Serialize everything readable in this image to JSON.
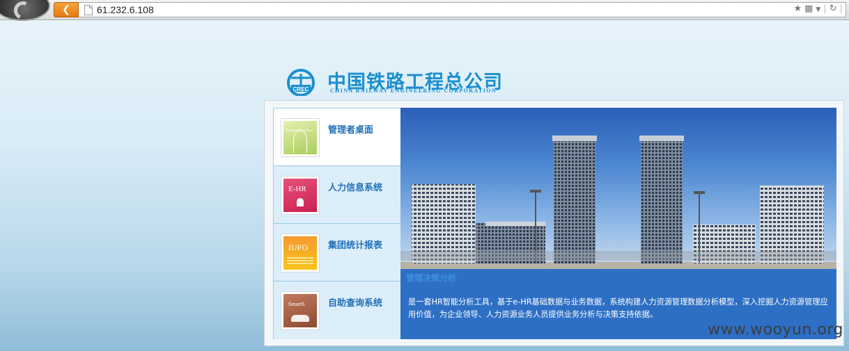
{
  "browser": {
    "back_label": "❮",
    "url": "61.232.6.108",
    "icons": [
      "star-icon",
      "qr-code-icon",
      "dropdown-icon",
      "reload-icon"
    ]
  },
  "brand": {
    "name_cn": "中国铁路工程总公司",
    "name_en": "CHINA RAILWAY ENGINEERING CORPORATION",
    "emblem_text": "CREC"
  },
  "menu": {
    "items": [
      {
        "label": "管理者桌面",
        "tile_text": "BusinessQuestions",
        "icon": "bq-app-icon",
        "active": true
      },
      {
        "label": "人力信息系统",
        "tile_text": "E-HR",
        "icon": "ehr-app-icon",
        "active": false
      },
      {
        "label": "集团统计报表",
        "tile_text": "IUFO",
        "icon": "iufo-app-icon",
        "active": false
      },
      {
        "label": "自助查询系统",
        "tile_text": "SmartS",
        "icon": "selfservice-app-icon",
        "active": false
      }
    ]
  },
  "feature": {
    "title": "管理决策分析",
    "description": "是一套HR智能分析工具，基于e-HR基础数据与业务数据，系统构建人力资源管理数据分析模型，深入挖掘人力资源管理应用价值，为企业领导、人力资源业务人员提供业务分析与决策支持依据。"
  },
  "watermark": "www.wooyun.org",
  "colors": {
    "brand_blue": "#1a8fd0",
    "menu_label": "#1f6fb8",
    "feature_bg": "#2d6fc4",
    "back_button": "#e67a10"
  }
}
